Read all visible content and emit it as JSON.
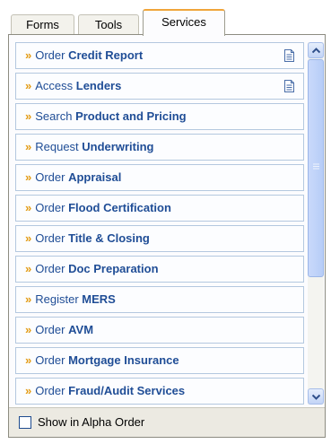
{
  "tabs": [
    {
      "label": "Forms",
      "active": false
    },
    {
      "label": "Tools",
      "active": false
    },
    {
      "label": "Services",
      "active": true
    }
  ],
  "services": [
    {
      "verb": "Order",
      "noun": "Credit Report",
      "has_doc_icon": true
    },
    {
      "verb": "Access",
      "noun": "Lenders",
      "has_doc_icon": true
    },
    {
      "verb": "Search",
      "noun": "Product and Pricing",
      "has_doc_icon": false
    },
    {
      "verb": "Request",
      "noun": "Underwriting",
      "has_doc_icon": false
    },
    {
      "verb": "Order",
      "noun": "Appraisal",
      "has_doc_icon": false
    },
    {
      "verb": "Order",
      "noun": "Flood Certification",
      "has_doc_icon": false
    },
    {
      "verb": "Order",
      "noun": "Title & Closing",
      "has_doc_icon": false
    },
    {
      "verb": "Order",
      "noun": "Doc Preparation",
      "has_doc_icon": false
    },
    {
      "verb": "Register",
      "noun": "MERS",
      "has_doc_icon": false
    },
    {
      "verb": "Order",
      "noun": "AVM",
      "has_doc_icon": false
    },
    {
      "verb": "Order",
      "noun": "Mortgage Insurance",
      "has_doc_icon": false
    },
    {
      "verb": "Order",
      "noun": "Fraud/Audit Services",
      "has_doc_icon": false
    }
  ],
  "chevron": "»",
  "footer": {
    "checkbox_label": "Show in Alpha Order",
    "checked": false
  },
  "colors": {
    "link": "#1f4d96",
    "chevron": "#e39b14",
    "active_tab_accent": "#f0a53a"
  }
}
